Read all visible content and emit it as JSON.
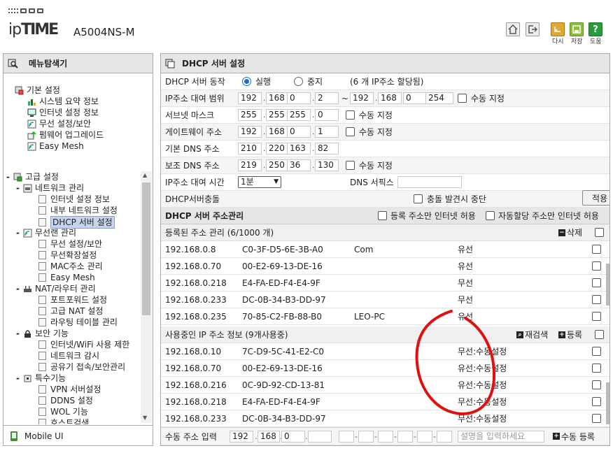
{
  "header": {
    "brand": "ipTIME",
    "model": "A5004NS-M",
    "buttons": [
      {
        "label": "",
        "icon": "home-icon"
      },
      {
        "label": "",
        "icon": "logout-icon"
      },
      {
        "label": "다시",
        "icon": "reload-icon"
      },
      {
        "label": "저장",
        "icon": "save-icon"
      },
      {
        "label": "도움",
        "icon": "help-icon"
      }
    ]
  },
  "sidebar": {
    "title": "메뉴탐색기",
    "groups": [
      {
        "label": "기본 설정",
        "items": [
          "시스템 요약 정보",
          "인터넷 설정 정보",
          "무선 설정/보안",
          "펌웨어 업그레이드",
          "Easy Mesh"
        ]
      },
      {
        "label": "고급 설정",
        "subgroups": [
          {
            "label": "네트워크 관리",
            "items": [
              "인터넷 설정 정보",
              "내부 네트워크 설정",
              "DHCP 서버 설정"
            ]
          },
          {
            "label": "무선랜 관리",
            "items": [
              "무선 설정/보안",
              "무선확장설정",
              "MAC주소 관리",
              "Easy Mesh"
            ]
          },
          {
            "label": "NAT/라우터 관리",
            "items": [
              "포트포워드 설정",
              "고급 NAT 설정",
              "라우팅 테이블 관리"
            ]
          },
          {
            "label": "보안 기능",
            "items": [
              "인터넷/WiFi 사용 제한",
              "네트워크 감시",
              "공유기 접속/보안관리"
            ]
          },
          {
            "label": "특수기능",
            "items": [
              "VPN 서버설정",
              "DDNS 설정",
              "WOL 기능",
              "호스트검색"
            ]
          }
        ]
      }
    ],
    "selected": "DHCP 서버 설정",
    "mobile_label": "Mobile UI"
  },
  "main": {
    "title": "DHCP 서버 설정",
    "server_action": {
      "label": "DHCP 서버 동작",
      "on": "실행",
      "off": "중지",
      "note": "(6 개 IP주소 할당됨)"
    },
    "lease_range": {
      "label": "IP주소 대여 범위",
      "start": [
        "192",
        "168",
        "0",
        "2"
      ],
      "sep": "~",
      "end": [
        "192",
        "168",
        "0",
        "254"
      ],
      "manual": "수동 지정"
    },
    "subnet": {
      "label": "서브넷 마스크",
      "value": [
        "255",
        "255",
        "255",
        "0"
      ],
      "manual": "수동 지정"
    },
    "gateway": {
      "label": "게이트웨이 주소",
      "value": [
        "192",
        "168",
        "0",
        "1"
      ],
      "manual": "수동 지정"
    },
    "dns1": {
      "label": "기본 DNS 주소",
      "value": [
        "210",
        "220",
        "163",
        "82"
      ]
    },
    "dns2": {
      "label": "보조 DNS 주소",
      "value": [
        "219",
        "250",
        "36",
        "130"
      ],
      "manual": "수동 지정"
    },
    "lease_time": {
      "label": "IP주소 대여 시간",
      "value": "1분",
      "dns_suffix_label": "DNS 서픽스",
      "dns_suffix_value": ""
    },
    "conflict": {
      "label": "DHCP서버충돌",
      "check": "충돌 발견시 중단",
      "apply": "적용"
    },
    "addr_mgmt": {
      "label": "DHCP 서버 주소관리",
      "opt1": "등록 주소만 인터넷 허용",
      "opt2": "자동할당 주소만 인터넷 허용"
    },
    "registered": {
      "label": "등록된 주소 관리 (6/1000 개)",
      "delete": "삭제",
      "rows": [
        {
          "ip": "192.168.0.8",
          "mac": "C0-3F-D5-6E-3B-A0",
          "name": "Com",
          "type": "유선"
        },
        {
          "ip": "192.168.0.70",
          "mac": "00-E2-69-13-DE-16",
          "name": "",
          "type": "유선"
        },
        {
          "ip": "192.168.0.218",
          "mac": "E4-FA-ED-F4-E4-9F",
          "name": "",
          "type": "무선"
        },
        {
          "ip": "192.168.0.233",
          "mac": "DC-0B-34-B3-DD-97",
          "name": "",
          "type": "무선"
        },
        {
          "ip": "192.168.0.235",
          "mac": "70-85-C2-FB-88-B0",
          "name": "LEO-PC",
          "type": "유선"
        }
      ]
    },
    "in_use": {
      "label": "사용중인 IP 주소 정보 (9개사용중)",
      "rescan": "재검색",
      "register": "등록",
      "rows": [
        {
          "ip": "192.168.0.10",
          "mac": "7C-D9-5C-41-E2-C0",
          "type": "무선:수동설정"
        },
        {
          "ip": "192.168.0.70",
          "mac": "00-E2-69-13-DE-16",
          "type": "유선:수동설정"
        },
        {
          "ip": "192.168.0.216",
          "mac": "0C-9D-92-CD-13-81",
          "type": "유선:수동설정"
        },
        {
          "ip": "192.168.0.218",
          "mac": "E4-FA-ED-F4-E4-9F",
          "type": "무선:수동설정"
        },
        {
          "ip": "192.168.0.233",
          "mac": "DC-0B-34-B3-DD-97",
          "type": "무선:수동설정"
        }
      ]
    },
    "manual_input": {
      "label": "수동 주소 입력",
      "ip": [
        "192",
        "168",
        "0",
        ""
      ],
      "mac": [
        "",
        "",
        "",
        "",
        "",
        ""
      ],
      "desc_placeholder": "설명을 입력하세요",
      "register": "수동 등록"
    }
  },
  "colors": {
    "annotation": "#e01010",
    "selected_bg": "#c8d4ec",
    "radio_on": "#1a6fd6"
  }
}
